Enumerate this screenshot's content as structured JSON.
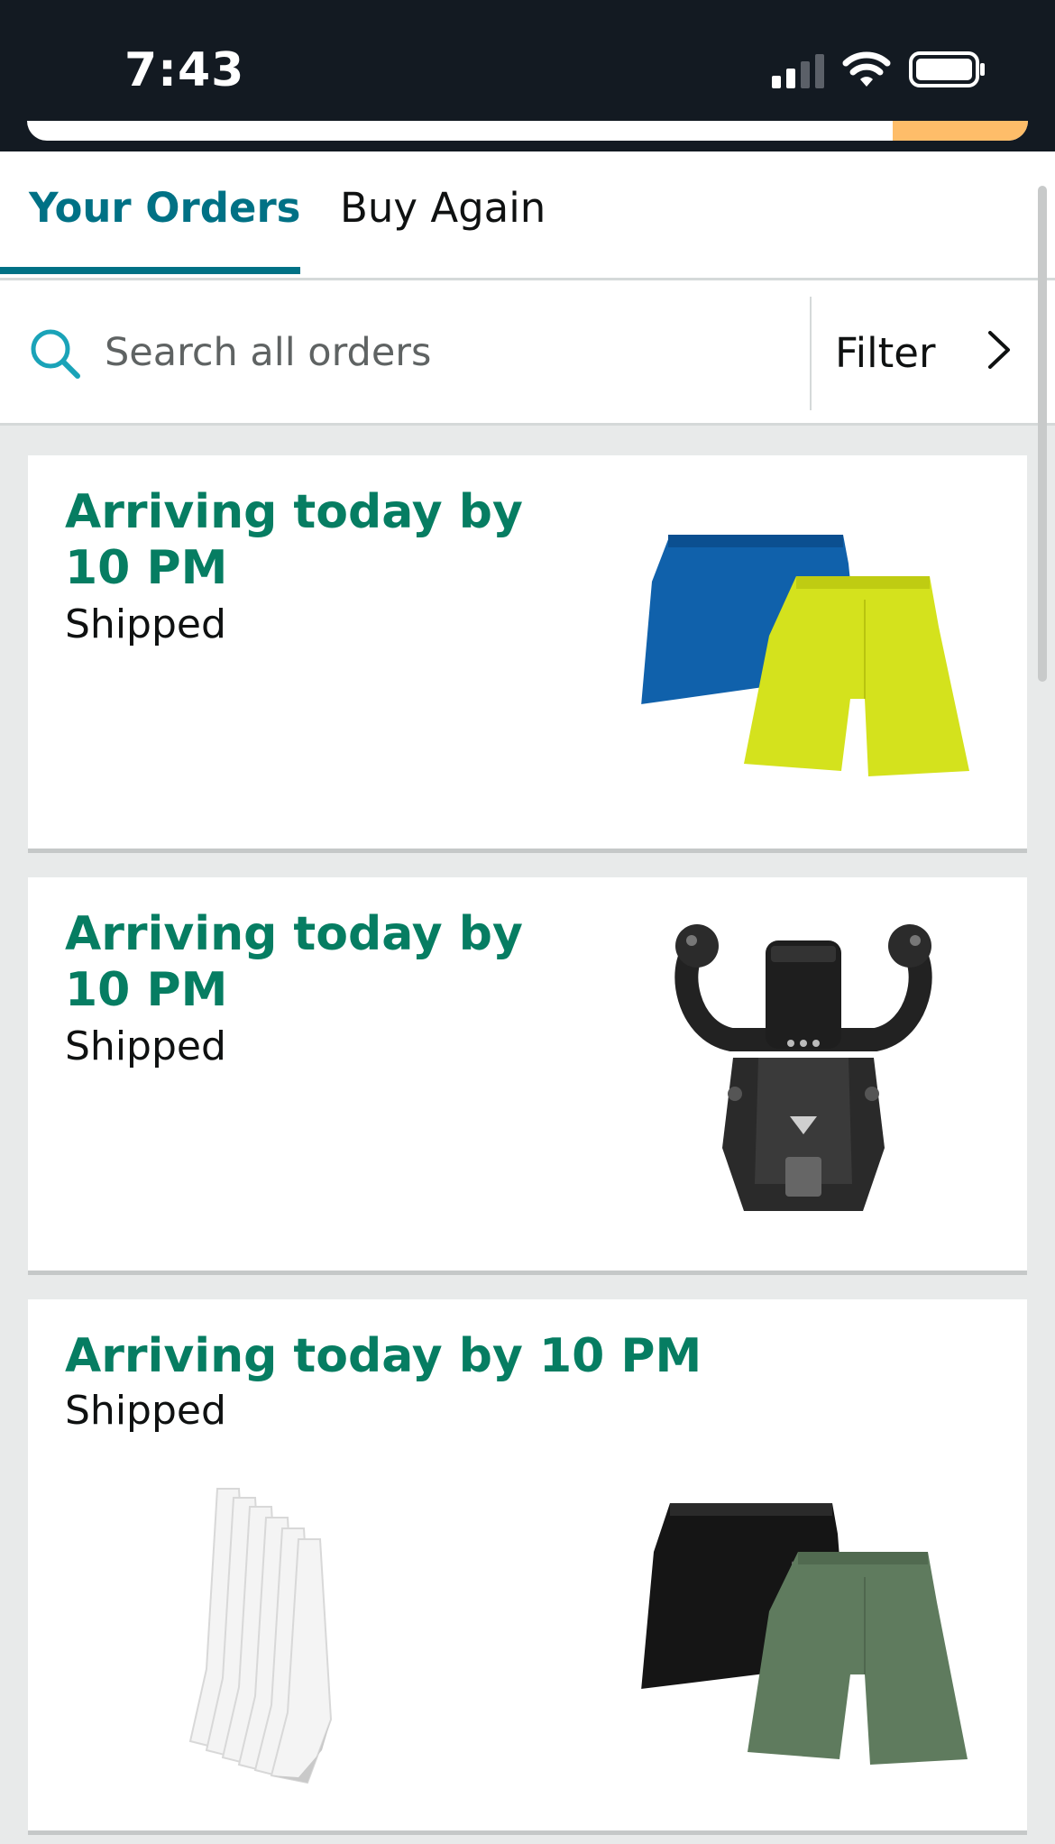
{
  "status_bar": {
    "time": "7:43"
  },
  "tabs": [
    {
      "label": "Your Orders",
      "active": true
    },
    {
      "label": "Buy Again",
      "active": false
    }
  ],
  "search": {
    "placeholder": "Search all orders",
    "filter_label": "Filter"
  },
  "orders": [
    {
      "title_line1": "Arriving today by",
      "title_line2": "10 PM",
      "status": "Shipped",
      "items": [
        "shorts-blue-and-lime-image"
      ]
    },
    {
      "title_line1": "Arriving today by",
      "title_line2": "10 PM",
      "status": "Shipped",
      "items": [
        "flight-yoke-controller-image"
      ]
    },
    {
      "title": "Arriving today by 10 PM",
      "status": "Shipped",
      "items": [
        "white-socks-pack-image",
        "shorts-black-and-green-image"
      ]
    }
  ],
  "colors": {
    "accent_teal": "#007185",
    "arrival_green": "#067d62",
    "status_bar_bg": "#131a22",
    "search_button_orange": "#febd69"
  }
}
